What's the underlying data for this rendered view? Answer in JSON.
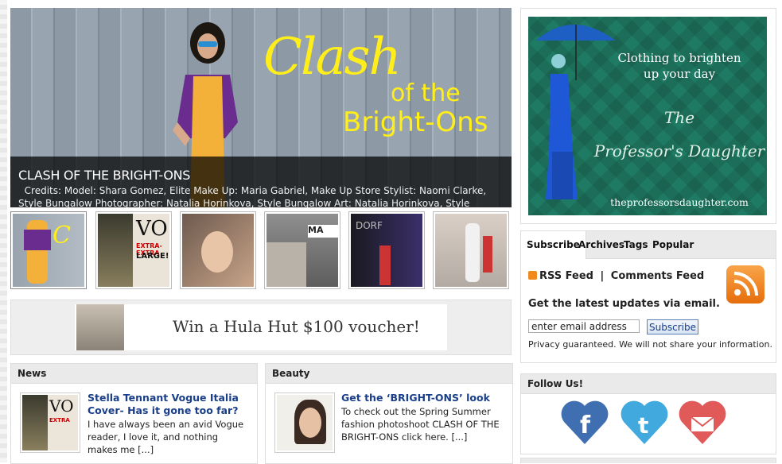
{
  "slider": {
    "title": "CLASH OF THE BRIGHT-ONS",
    "credits_line1_prefix": "Credits: Model: Shara Gomez, ",
    "credits_line1_elite": "Elite",
    "credits_line1_suffix": " Make Up: Maria Gabriel, Make Up Store Stylist: Naomi Clarke,",
    "credits_line2": "Style Bungalow Photographer: Natalia Horinkova, Style Bungalow Art: Natalia Horinkova, Style",
    "art_word": "Clash",
    "art_of": "of the",
    "art_bright": "Bright-Ons"
  },
  "thumbnails": [
    {
      "label": "Clash of the Bright-Ons"
    },
    {
      "label": "Vogue Extra-Extra Large"
    },
    {
      "label": "Portrait"
    },
    {
      "label": "Street store"
    },
    {
      "label": "Runway"
    },
    {
      "label": "Catwalk"
    }
  ],
  "ad_banner": {
    "text": "Win a Hula Hut $100 voucher!"
  },
  "news": {
    "heading": "News",
    "post_title": "Stella Tennant Vogue Italia Cover- Has it gone too far?",
    "excerpt": "I have always been an avid Vogue reader, I love it, and nothing makes me [...]"
  },
  "beauty": {
    "heading": "Beauty",
    "post_title": "Get the ‘BRIGHT-ONS’ look",
    "excerpt": "To check out the Spring Summer fashion photoshoot CLASH OF THE BRIGHT-ONS click here. [...]"
  },
  "sidebar_ad": {
    "tagline_line1": "Clothing to brighten",
    "tagline_line2": "up your day",
    "brand_line1": "The",
    "brand_line2": "Professor's Daughter",
    "url": "theprofessorsdaughter.com"
  },
  "subscribe": {
    "tabs": [
      "Subscribe",
      "Archives",
      "Tags",
      "Popular"
    ],
    "rss_feed": "RSS Feed",
    "separator": "|",
    "comments_feed": "Comments Feed",
    "email_label": "Get the latest updates via email.",
    "email_value": "enter email address",
    "button": "Subscribe",
    "privacy": "Privacy guaranteed. We will not share your information."
  },
  "follow": {
    "heading": "Follow Us!",
    "icons": [
      "facebook-heart-icon",
      "twitter-heart-icon",
      "email-heart-icon"
    ]
  },
  "colors": {
    "link_blue": "#1a3f8a",
    "accent_yellow": "#ffee1a",
    "rss_orange": "#f08a1c"
  }
}
